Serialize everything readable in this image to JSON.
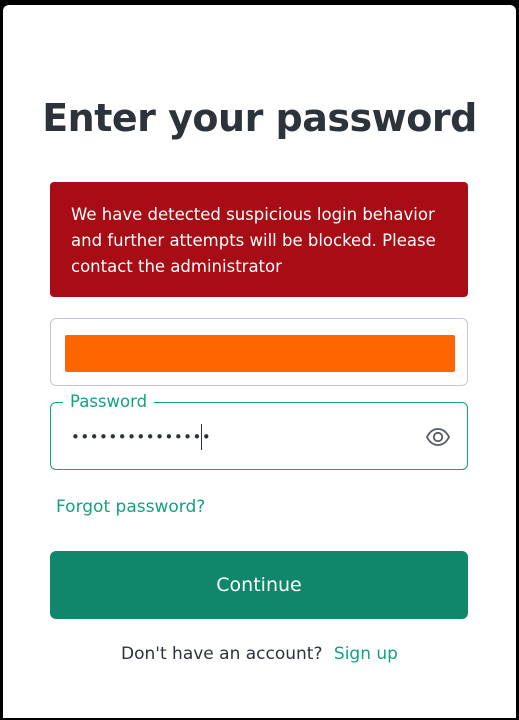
{
  "page": {
    "title": "Enter your password"
  },
  "alert": {
    "message": "We have detected suspicious login behavior and further attempts will be blocked. Please contact the administrator",
    "color": "#a80c14"
  },
  "password_field": {
    "label": "Password",
    "value_masked": "•••••••••••••••",
    "toggle_icon": "eye-icon"
  },
  "links": {
    "forgot_password": "Forgot password?"
  },
  "buttons": {
    "continue_label": "Continue",
    "continue_color": "#10876a"
  },
  "footer": {
    "prompt": "Don't have an account?",
    "signup_label": "Sign up"
  },
  "colors": {
    "accent": "#10a37f",
    "redaction": "#ff6600",
    "title": "#2d333a"
  }
}
